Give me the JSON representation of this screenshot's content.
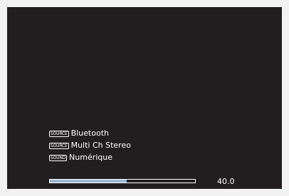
{
  "osd": {
    "source_badge": "SOURCE",
    "sound_badge": "SOUND",
    "input_source": "Bluetooth",
    "output_source": "Multi Ch Stereo",
    "sound_mode": "Numérique"
  },
  "volume": {
    "display_value": "40.0",
    "level_fraction": 0.53
  },
  "colors": {
    "background": "#221e1f",
    "text": "#ffffff",
    "volume_fill": "#9cb9d6"
  }
}
